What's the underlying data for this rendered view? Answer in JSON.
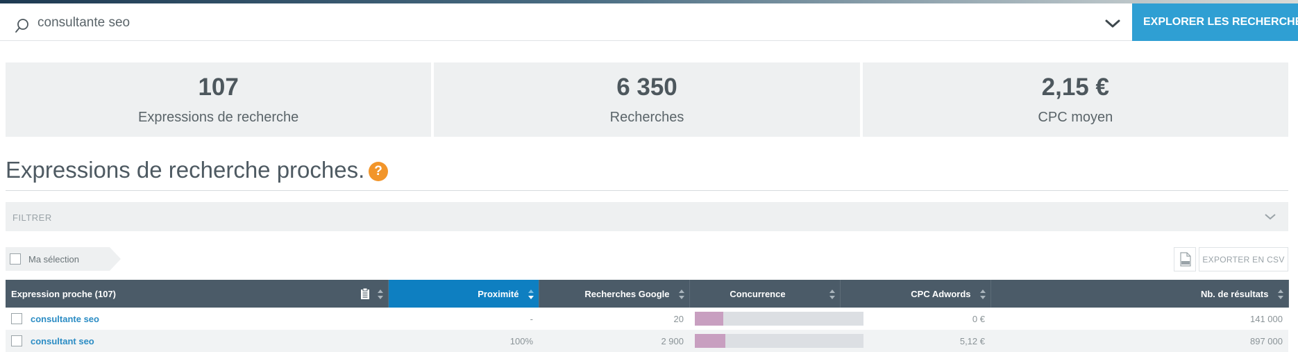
{
  "search": {
    "query": "consultante seo",
    "button_label": "EXPLORER LES RECHERCHES",
    "icon": "search-icon"
  },
  "stats": [
    {
      "value": "107",
      "label": "Expressions de recherche"
    },
    {
      "value": "6 350",
      "label": "Recherches"
    },
    {
      "value": "2,15 €",
      "label": "CPC moyen"
    }
  ],
  "section": {
    "title": "Expressions de recherche proches.",
    "help": "?"
  },
  "filter": {
    "label": "FILTRER"
  },
  "selection": {
    "label": "Ma sélection"
  },
  "export": {
    "label": "EXPORTER EN CSV",
    "icon": "csv-file-icon"
  },
  "table": {
    "columns": [
      "Expression proche (107)",
      "Proximité",
      "Recherches Google",
      "Concurrence",
      "CPC Adwords",
      "Nb. de résultats"
    ],
    "active_sort_column": "Proximité",
    "rows": [
      {
        "keyword": "consultante seo",
        "proximity": "-",
        "searches": "20",
        "competition": 0.17,
        "cpc": "0 €",
        "results": "141 000"
      },
      {
        "keyword": "consultant seo",
        "proximity": "100%",
        "searches": "2 900",
        "competition": 0.18,
        "cpc": "5,12 €",
        "results": "897 000"
      }
    ]
  },
  "colors": {
    "accent": "#2f9fd3",
    "header_bg": "#4b5b68",
    "active_header": "#0e7fc1",
    "help": "#f2952a",
    "competition_fill": "#c89fc0",
    "link": "#2b8cc4"
  }
}
